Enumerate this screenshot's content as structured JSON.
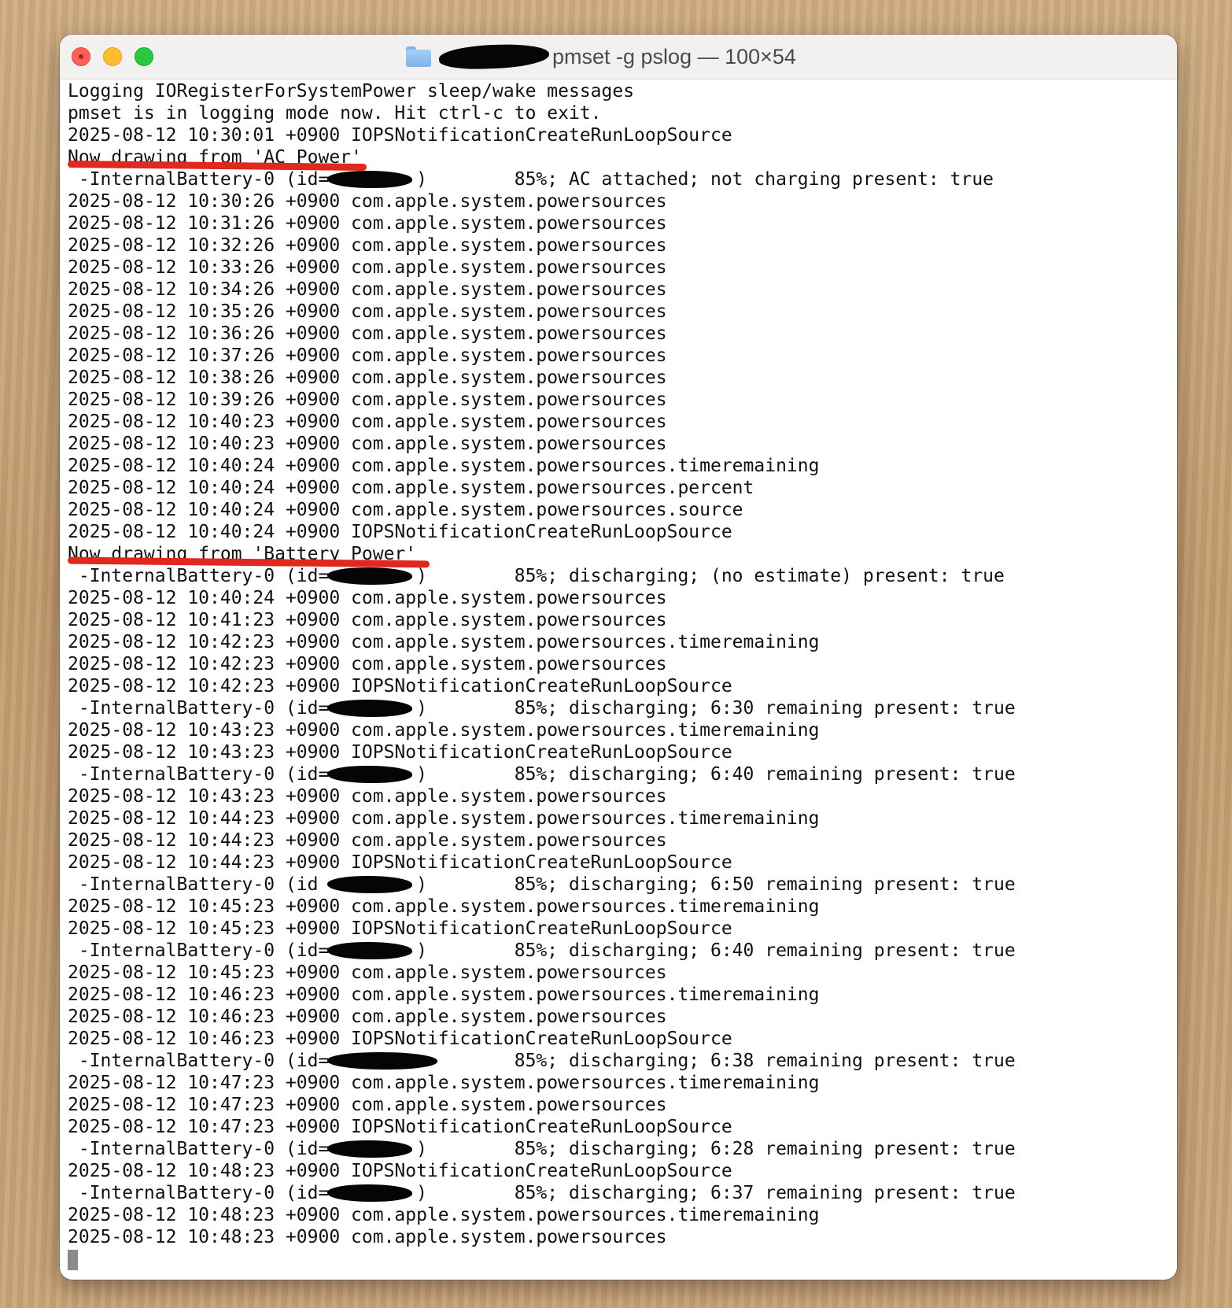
{
  "window": {
    "title": "pmset -g pslog — 100×54",
    "folder_icon": "folder-icon",
    "controls": {
      "close": "close-button",
      "minimize": "minimize-button",
      "zoom": "zoom-button"
    }
  },
  "terminal": {
    "lines": [
      "Logging IORegisterForSystemPower sleep/wake messages",
      "pmset is in logging mode now. Hit ctrl-c to exit.",
      "2025-08-12 10:30:01 +0900 IOPSNotificationCreateRunLoopSource",
      "Now drawing from 'AC Power'",
      " -InternalBattery-0 (id=        )        85%; AC attached; not charging present: true",
      "2025-08-12 10:30:26 +0900 com.apple.system.powersources",
      "2025-08-12 10:31:26 +0900 com.apple.system.powersources",
      "2025-08-12 10:32:26 +0900 com.apple.system.powersources",
      "2025-08-12 10:33:26 +0900 com.apple.system.powersources",
      "2025-08-12 10:34:26 +0900 com.apple.system.powersources",
      "2025-08-12 10:35:26 +0900 com.apple.system.powersources",
      "2025-08-12 10:36:26 +0900 com.apple.system.powersources",
      "2025-08-12 10:37:26 +0900 com.apple.system.powersources",
      "2025-08-12 10:38:26 +0900 com.apple.system.powersources",
      "2025-08-12 10:39:26 +0900 com.apple.system.powersources",
      "2025-08-12 10:40:23 +0900 com.apple.system.powersources",
      "2025-08-12 10:40:23 +0900 com.apple.system.powersources",
      "2025-08-12 10:40:24 +0900 com.apple.system.powersources.timeremaining",
      "2025-08-12 10:40:24 +0900 com.apple.system.powersources.percent",
      "2025-08-12 10:40:24 +0900 com.apple.system.powersources.source",
      "2025-08-12 10:40:24 +0900 IOPSNotificationCreateRunLoopSource",
      "Now drawing from 'Battery Power'",
      " -InternalBattery-0 (id=        )        85%; discharging; (no estimate) present: true",
      "2025-08-12 10:40:24 +0900 com.apple.system.powersources",
      "2025-08-12 10:41:23 +0900 com.apple.system.powersources",
      "2025-08-12 10:42:23 +0900 com.apple.system.powersources.timeremaining",
      "2025-08-12 10:42:23 +0900 com.apple.system.powersources",
      "2025-08-12 10:42:23 +0900 IOPSNotificationCreateRunLoopSource",
      " -InternalBattery-0 (id=        )        85%; discharging; 6:30 remaining present: true",
      "2025-08-12 10:43:23 +0900 com.apple.system.powersources.timeremaining",
      "2025-08-12 10:43:23 +0900 IOPSNotificationCreateRunLoopSource",
      " -InternalBattery-0 (id=        )        85%; discharging; 6:40 remaining present: true",
      "2025-08-12 10:43:23 +0900 com.apple.system.powersources",
      "2025-08-12 10:44:23 +0900 com.apple.system.powersources.timeremaining",
      "2025-08-12 10:44:23 +0900 com.apple.system.powersources",
      "2025-08-12 10:44:23 +0900 IOPSNotificationCreateRunLoopSource",
      " -InternalBattery-0 (id         )        85%; discharging; 6:50 remaining present: true",
      "2025-08-12 10:45:23 +0900 com.apple.system.powersources.timeremaining",
      "2025-08-12 10:45:23 +0900 IOPSNotificationCreateRunLoopSource",
      " -InternalBattery-0 (id=        )        85%; discharging; 6:40 remaining present: true",
      "2025-08-12 10:45:23 +0900 com.apple.system.powersources",
      "2025-08-12 10:46:23 +0900 com.apple.system.powersources.timeremaining",
      "2025-08-12 10:46:23 +0900 com.apple.system.powersources",
      "2025-08-12 10:46:23 +0900 IOPSNotificationCreateRunLoopSource",
      " -InternalBattery-0 (id=                 85%; discharging; 6:38 remaining present: true",
      "2025-08-12 10:47:23 +0900 com.apple.system.powersources.timeremaining",
      "2025-08-12 10:47:23 +0900 com.apple.system.powersources",
      "2025-08-12 10:47:23 +0900 IOPSNotificationCreateRunLoopSource",
      " -InternalBattery-0 (id=        )        85%; discharging; 6:28 remaining present: true",
      "2025-08-12 10:48:23 +0900 IOPSNotificationCreateRunLoopSource",
      " -InternalBattery-0 (id=        )        85%; discharging; 6:37 remaining present: true",
      "2025-08-12 10:48:23 +0900 com.apple.system.powersources.timeremaining",
      "2025-08-12 10:48:23 +0900 com.apple.system.powersources"
    ]
  },
  "colors": {
    "highlight": "#e1281e",
    "redaction": "#050505"
  }
}
